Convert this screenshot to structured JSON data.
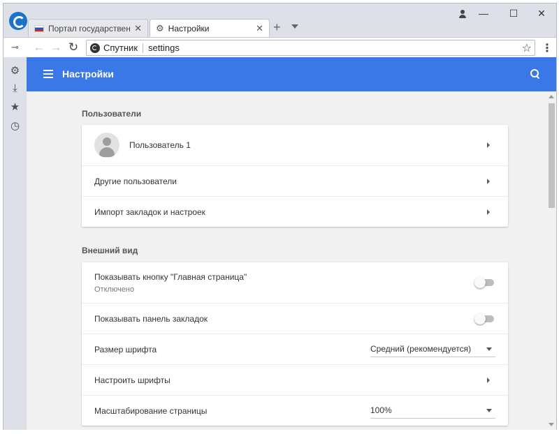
{
  "tabs": [
    {
      "title": "Портал государственны",
      "close": "✕"
    },
    {
      "title": "Настройки",
      "close": "✕"
    }
  ],
  "tabstrip": {
    "new_tab": "+"
  },
  "window_controls": {
    "minimize": "—",
    "maximize": "☐",
    "close": "✕"
  },
  "toolbar": {
    "back": "←",
    "forward": "→",
    "reload": "↻",
    "site_name": "Спутник",
    "url": "settings",
    "bookmark_star": "☆",
    "menu": "⋮"
  },
  "sidebar": {
    "icons": [
      "pin-icon",
      "gear-icon",
      "download-icon",
      "star-icon",
      "history-icon"
    ]
  },
  "header": {
    "title": "Настройки"
  },
  "sections": {
    "users": {
      "title": "Пользователи",
      "profile_name": "Пользователь 1",
      "other_users": "Другие пользователи",
      "import": "Импорт закладок и настроек"
    },
    "appearance": {
      "title": "Внешний вид",
      "home_button": "Показывать кнопку \"Главная страница\"",
      "home_button_status": "Отключено",
      "bookmarks_bar": "Показывать панель закладок",
      "font_size": "Размер шрифта",
      "font_size_value": "Средний (рекомендуется)",
      "customize_fonts": "Настроить шрифты",
      "page_zoom": "Масштабирование страницы",
      "page_zoom_value": "100%"
    }
  },
  "colors": {
    "accent": "#3b78e7",
    "page_bg": "#f1f1f1",
    "chrome_bg": "#dde0e6"
  }
}
